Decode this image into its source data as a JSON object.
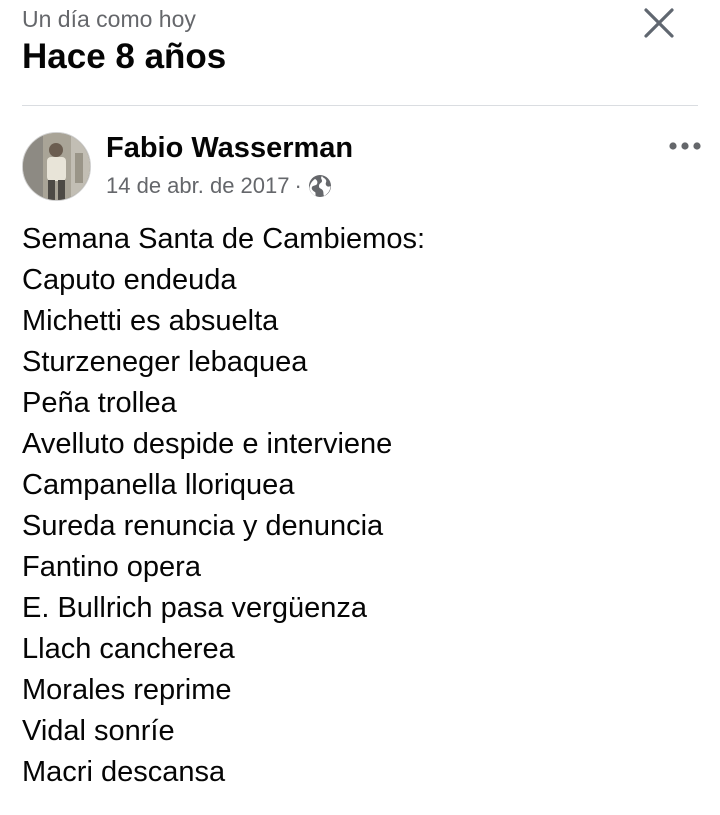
{
  "header": {
    "subtitle": "Un día como hoy",
    "title": "Hace 8 años"
  },
  "icons": {
    "close": "close-icon",
    "more": "more-options-icon",
    "privacy": "globe-icon",
    "avatar": "profile-photo"
  },
  "post": {
    "author": "Fabio Wasserman",
    "date": "14 de abr. de 2017",
    "separator": "·",
    "lines": [
      "Semana Santa de Cambiemos:",
      "Caputo endeuda",
      "Michetti es absuelta",
      "Sturzeneger lebaquea",
      "Peña trollea",
      "Avelluto despide e interviene",
      "Campanella lloriquea",
      "Sureda renuncia y denuncia",
      "Fantino opera",
      "E. Bullrich pasa vergüenza",
      "Llach cancherea",
      "Morales reprime",
      "Vidal sonríe",
      "Macri descansa"
    ]
  },
  "colors": {
    "text_primary": "#050505",
    "text_secondary": "#65676b",
    "divider": "#dadde1"
  }
}
